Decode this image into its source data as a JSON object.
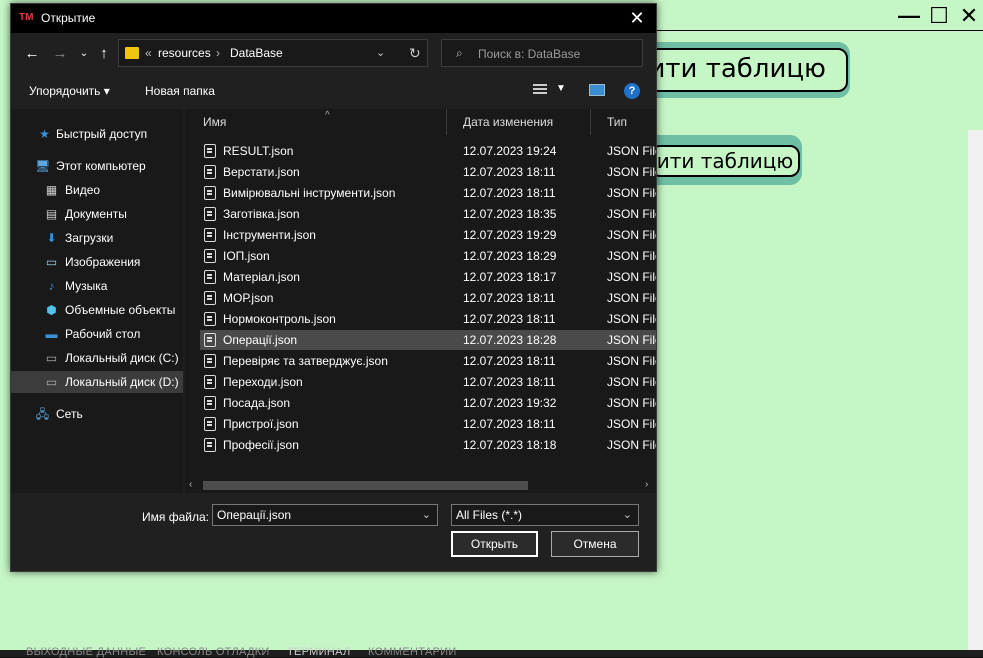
{
  "dialog": {
    "title": "Открытие",
    "app_icon_text": "TM",
    "address": {
      "overflow": "«",
      "crumbs": [
        "resources",
        "DataBase"
      ]
    },
    "search_placeholder": "Поиск в: DataBase",
    "toolbar": {
      "organize": "Упорядочить ▾",
      "new_folder": "Новая папка"
    },
    "sidebar": [
      {
        "label": "Быстрый доступ",
        "icon": "star-icon"
      },
      {
        "label": "Этот компьютер",
        "icon": "computer-icon"
      },
      {
        "label": "Видео",
        "icon": "video-icon"
      },
      {
        "label": "Документы",
        "icon": "documents-icon"
      },
      {
        "label": "Загрузки",
        "icon": "download-icon"
      },
      {
        "label": "Изображения",
        "icon": "pictures-icon"
      },
      {
        "label": "Музыка",
        "icon": "music-icon"
      },
      {
        "label": "Объемные объекты",
        "icon": "3d-objects-icon"
      },
      {
        "label": "Рабочий стол",
        "icon": "desktop-icon"
      },
      {
        "label": "Локальный диск (C:)",
        "icon": "drive-c-icon"
      },
      {
        "label": "Локальный диск (D:)",
        "icon": "drive-d-icon",
        "selected": true
      },
      {
        "label": "Сеть",
        "icon": "network-icon"
      }
    ],
    "columns": {
      "name": "Имя",
      "date": "Дата изменения",
      "type": "Тип"
    },
    "files": [
      {
        "name": "RESULT.json",
        "date": "12.07.2023 19:24",
        "type": "JSON File"
      },
      {
        "name": "Верстати.json",
        "date": "12.07.2023 18:11",
        "type": "JSON File"
      },
      {
        "name": "Вимірювальні інструменти.json",
        "date": "12.07.2023 18:11",
        "type": "JSON File"
      },
      {
        "name": "Заготівка.json",
        "date": "12.07.2023 18:35",
        "type": "JSON File"
      },
      {
        "name": "Інструменти.json",
        "date": "12.07.2023 19:29",
        "type": "JSON File"
      },
      {
        "name": "ІОП.json",
        "date": "12.07.2023 18:29",
        "type": "JSON File"
      },
      {
        "name": "Матеріал.json",
        "date": "12.07.2023 18:17",
        "type": "JSON File"
      },
      {
        "name": "МОР.json",
        "date": "12.07.2023 18:11",
        "type": "JSON File"
      },
      {
        "name": "Нормоконтроль.json",
        "date": "12.07.2023 18:11",
        "type": "JSON File"
      },
      {
        "name": "Операції.json",
        "date": "12.07.2023 18:28",
        "type": "JSON File",
        "selected": true
      },
      {
        "name": "Перевіряє та затверджує.json",
        "date": "12.07.2023 18:11",
        "type": "JSON File"
      },
      {
        "name": "Переходи.json",
        "date": "12.07.2023 18:11",
        "type": "JSON File"
      },
      {
        "name": "Посада.json",
        "date": "12.07.2023 19:32",
        "type": "JSON File"
      },
      {
        "name": "Пристрої.json",
        "date": "12.07.2023 18:11",
        "type": "JSON File"
      },
      {
        "name": "Професії.json",
        "date": "12.07.2023 18:18",
        "type": "JSON File"
      }
    ],
    "filename_label": "Имя файла:",
    "filename_value": "Операції.json",
    "filetype_value": "All Files (*.*)",
    "open_button": "Открыть",
    "cancel_button": "Отмена"
  },
  "background": {
    "button_big": "рити таблицю",
    "button_small": "рити таблицю",
    "bottom_tabs": [
      "ВЫХОДНЫЕ ДАННЫЕ",
      "КОНСОЛЬ ОТЛАДКИ",
      "ТЕРМИНАЛ",
      "КОММЕНТАРИИ"
    ]
  }
}
